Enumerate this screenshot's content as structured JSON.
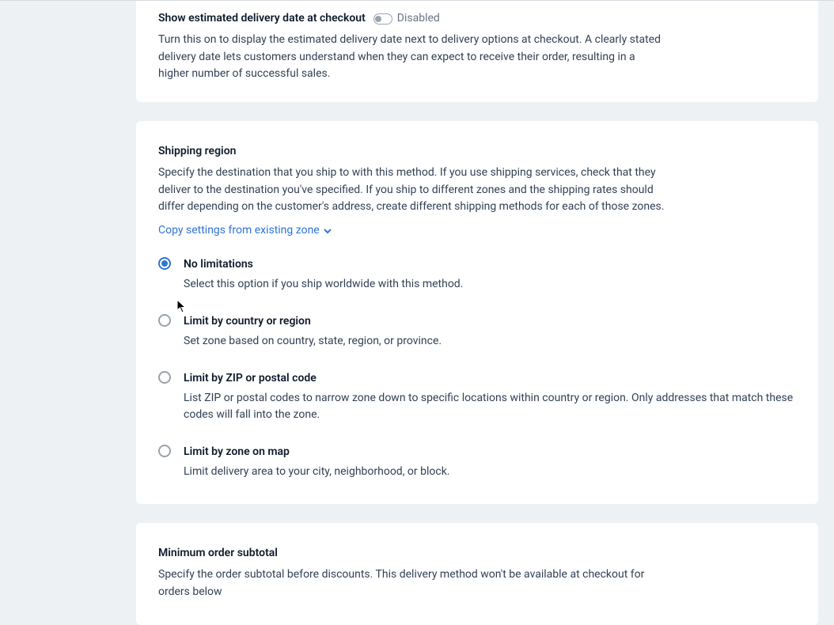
{
  "delivery_date": {
    "title": "Show estimated delivery date at checkout",
    "toggle_state": "Disabled",
    "description": "Turn this on to display the estimated delivery date next to delivery options at checkout. A clearly stated delivery date lets customers understand when they can expect to receive their order, resulting in a higher number of successful sales."
  },
  "shipping_region": {
    "title": "Shipping region",
    "description": "Specify the destination that you ship to with this method. If you use shipping services, check that they deliver to the destination you've specified. If you ship to different zones and the shipping rates should differ depending on the customer's address, create different shipping methods for each of those zones.",
    "copy_link": "Copy settings from existing zone",
    "options": [
      {
        "title": "No limitations",
        "desc": "Select this option if you ship worldwide with this method.",
        "checked": true
      },
      {
        "title": "Limit by country or region",
        "desc": "Set zone based on country, state, region, or province.",
        "checked": false
      },
      {
        "title": "Limit by ZIP or postal code",
        "desc": "List ZIP or postal codes to narrow zone down to specific locations within country or region. Only addresses that match these codes will fall into the zone.",
        "checked": false
      },
      {
        "title": "Limit by zone on map",
        "desc": "Limit delivery area to your city, neighborhood, or block.",
        "checked": false
      }
    ]
  },
  "min_subtotal": {
    "title": "Minimum order subtotal",
    "description": "Specify the order subtotal before discounts. This delivery method won't be available at checkout for orders below"
  }
}
